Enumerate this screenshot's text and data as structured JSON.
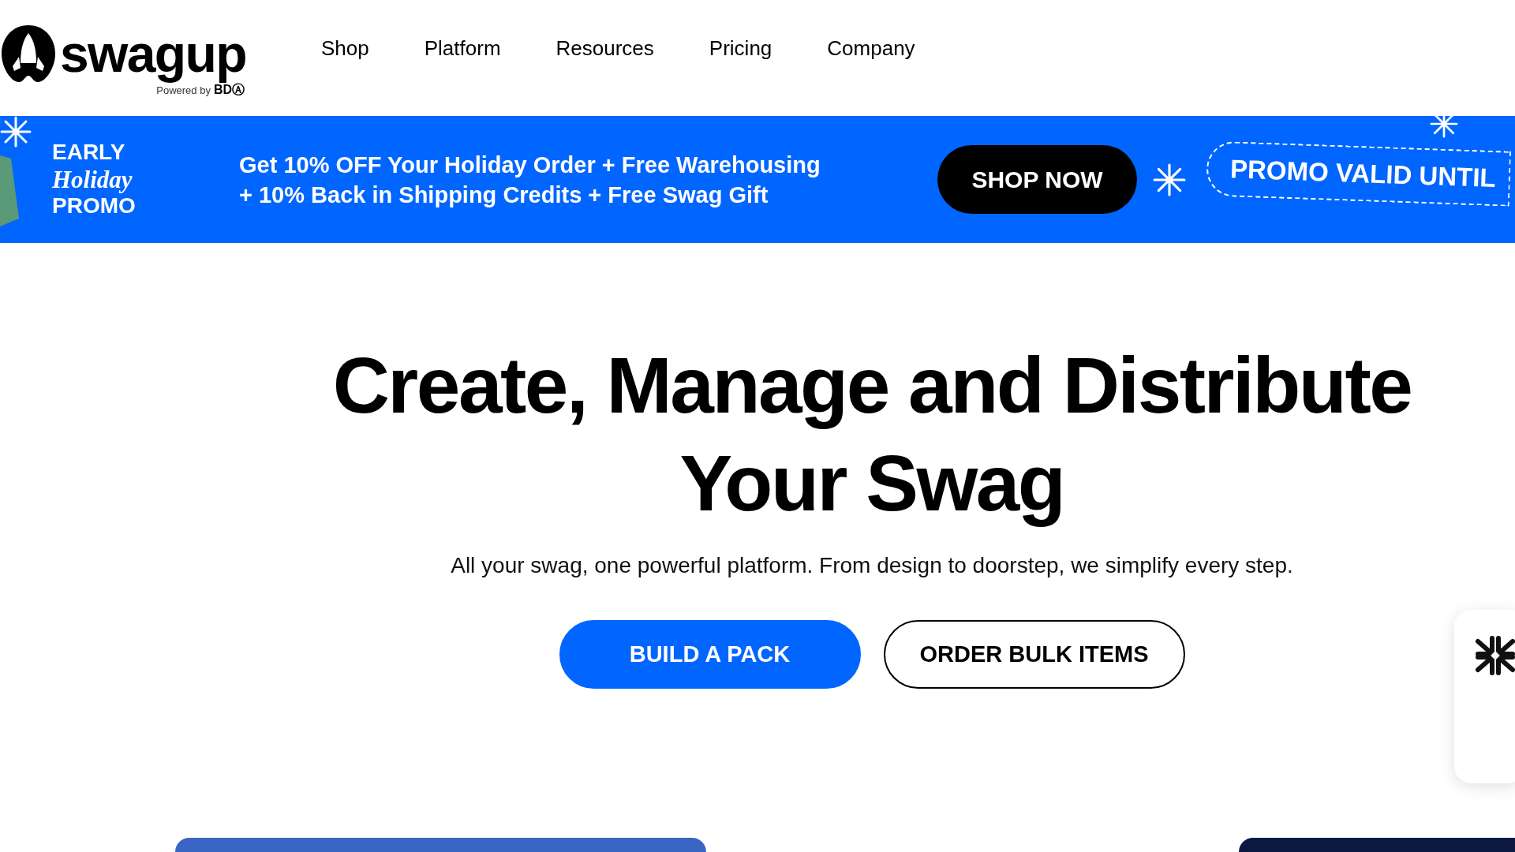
{
  "header": {
    "logo": {
      "wordmark": "swagup",
      "powered_by": "Powered by",
      "partner": "BDⒶ"
    },
    "nav": [
      {
        "label": "Shop"
      },
      {
        "label": "Platform"
      },
      {
        "label": "Resources"
      },
      {
        "label": "Pricing"
      },
      {
        "label": "Company"
      }
    ]
  },
  "banner": {
    "title_lines": [
      "EARLY",
      "Holiday",
      "PROMO"
    ],
    "offer_lines": [
      "Get 10% OFF Your Holiday Order + Free Warehousing",
      "+ 10% Back in Shipping Credits + Free Swag Gift"
    ],
    "button": "SHOP NOW",
    "promo": "PROMO VALID UNTIL"
  },
  "hero": {
    "headline_lines": [
      "Create, Manage and Distribute",
      "Your Swag"
    ],
    "subtitle": "All your swag, one powerful platform. From design to doorstep, we simplify every step.",
    "buttons": [
      {
        "label": "BUILD A PACK",
        "kind": "primary"
      },
      {
        "label": "ORDER BULK ITEMS",
        "kind": "outline"
      }
    ]
  }
}
